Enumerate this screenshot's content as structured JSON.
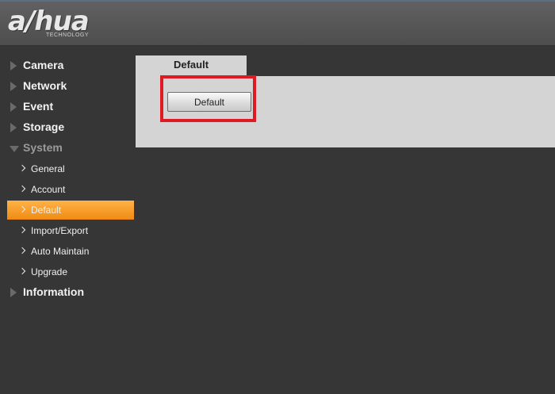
{
  "brand": {
    "logo_text": "a/hua",
    "tagline": "TECHNOLOGY"
  },
  "sidebar": {
    "categories": [
      {
        "label": "Camera",
        "expanded": false
      },
      {
        "label": "Network",
        "expanded": false
      },
      {
        "label": "Event",
        "expanded": false
      },
      {
        "label": "Storage",
        "expanded": false
      },
      {
        "label": "System",
        "expanded": true
      }
    ],
    "system_items": [
      {
        "label": "General"
      },
      {
        "label": "Account"
      },
      {
        "label": "Default",
        "active": true
      },
      {
        "label": "Import/Export"
      },
      {
        "label": "Auto Maintain"
      },
      {
        "label": "Upgrade"
      }
    ],
    "footer_category": {
      "label": "Information",
      "expanded": false
    }
  },
  "content": {
    "tab_label": "Default",
    "default_button_label": "Default"
  },
  "colors": {
    "accent_active": "#f5a031",
    "highlight_box": "#e01a22",
    "panel_bg": "#d4d4d4",
    "app_bg": "#363636"
  }
}
